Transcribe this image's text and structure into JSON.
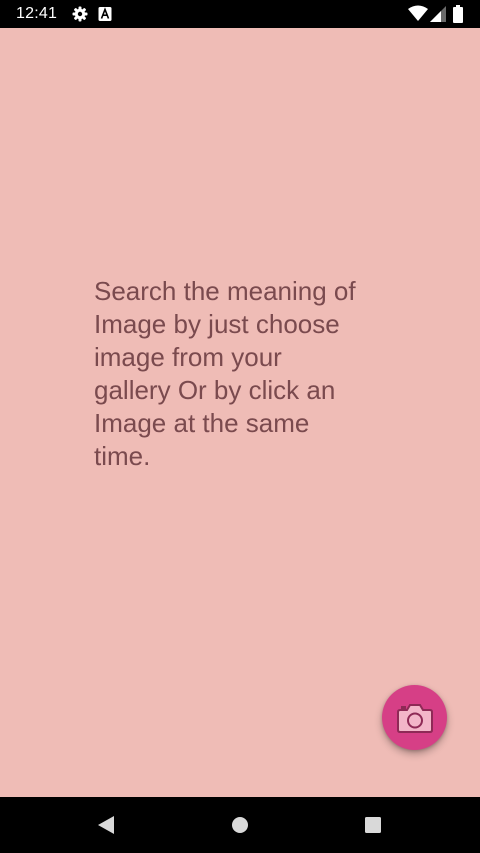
{
  "status_bar": {
    "time": "12:41",
    "left_icons": [
      "gear-icon",
      "a-badge-icon"
    ],
    "right_icons": [
      "wifi-icon",
      "signal-icon",
      "battery-icon"
    ]
  },
  "main": {
    "message": "Search the meaning of\nImage by just choose\nimage from your\ngallery Or by click an\nImage at the same\ntime.",
    "background_color": "#efbcb6",
    "text_color": "#7a4a4e"
  },
  "fab": {
    "icon": "camera-icon",
    "color": "#d63f86"
  },
  "nav_bar": {
    "buttons": [
      "back-icon",
      "home-icon",
      "recents-icon"
    ]
  }
}
